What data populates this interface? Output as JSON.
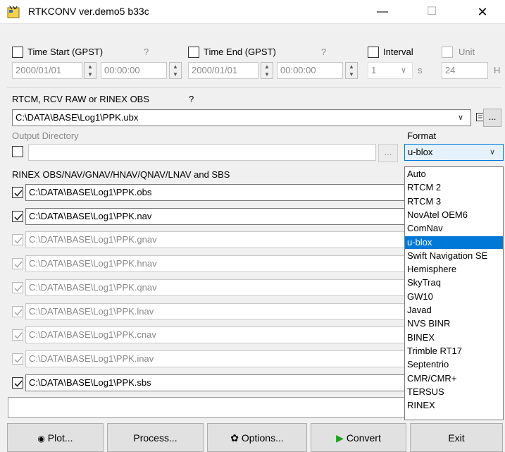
{
  "window": {
    "title": "RTKCONV ver.demo5 b33c",
    "minimize": "—",
    "maximize": "☐",
    "close": "✕"
  },
  "time": {
    "start_label": "Time Start (GPST)",
    "start_help": "?",
    "start_date": "2000/01/01",
    "start_time": "00:00:00",
    "end_label": "Time End (GPST)",
    "end_help": "?",
    "end_date": "2000/01/01",
    "end_time": "00:00:00",
    "interval_label": "Interval",
    "interval_value": "1",
    "interval_unit": "s",
    "unit_label": "Unit",
    "unit_value": "24",
    "unit_suffix": "H"
  },
  "input": {
    "label": "RTCM, RCV RAW or RINEX OBS",
    "help": "?",
    "path": "C:\\DATA\\BASE\\Log1\\PPK.ubx",
    "browse": "..."
  },
  "output": {
    "label": "Output Directory",
    "path": "",
    "browse": "...",
    "format_label": "Format",
    "format_value": "u-blox"
  },
  "rinex": {
    "label": "RINEX OBS/NAV/GNAV/HNAV/QNAV/LNAV and SBS",
    "files": [
      {
        "path": "C:\\DATA\\BASE\\Log1\\PPK.obs",
        "enabled": true
      },
      {
        "path": "C:\\DATA\\BASE\\Log1\\PPK.nav",
        "enabled": true
      },
      {
        "path": "C:\\DATA\\BASE\\Log1\\PPK.gnav",
        "enabled": false
      },
      {
        "path": "C:\\DATA\\BASE\\Log1\\PPK.hnav",
        "enabled": false
      },
      {
        "path": "C:\\DATA\\BASE\\Log1\\PPK.qnav",
        "enabled": false
      },
      {
        "path": "C:\\DATA\\BASE\\Log1\\PPK.lnav",
        "enabled": false
      },
      {
        "path": "C:\\DATA\\BASE\\Log1\\PPK.cnav",
        "enabled": false
      },
      {
        "path": "C:\\DATA\\BASE\\Log1\\PPK.inav",
        "enabled": false
      },
      {
        "path": "C:\\DATA\\BASE\\Log1\\PPK.sbs",
        "enabled": true
      }
    ]
  },
  "format_options": [
    "Auto",
    "RTCM 2",
    "RTCM 3",
    "NovAtel OEM6",
    "ComNav",
    "u-blox",
    "Swift Navigation SE",
    "Hemisphere",
    "SkyTraq",
    "GW10",
    "Javad",
    "NVS BINR",
    "BINEX",
    "Trimble RT17",
    "Septentrio",
    "CMR/CMR+",
    "TERSUS",
    "RINEX"
  ],
  "format_selected_index": 5,
  "status": "",
  "buttons": {
    "plot": "Plot...",
    "process": "Process...",
    "options": "Options...",
    "convert": "Convert",
    "exit": "Exit"
  },
  "icons": {
    "app": "app-icon",
    "plot": "plot-icon",
    "options": "gear-icon",
    "convert": "play-icon",
    "note": "notepad-icon"
  },
  "colors": {
    "selection": "#0078d7",
    "convert_arrow": "#1aa31a"
  }
}
